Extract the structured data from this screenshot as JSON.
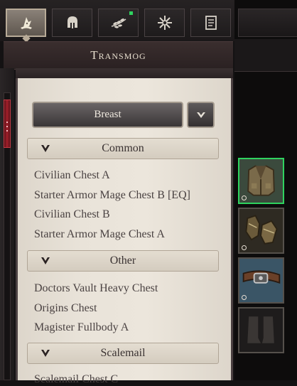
{
  "window": {
    "title": "Transmog"
  },
  "tabs": [
    {
      "name": "transmog",
      "icon": "wizard-hat-icon",
      "active": true
    },
    {
      "name": "helmet",
      "icon": "helmet-icon",
      "active": false
    },
    {
      "name": "laurel",
      "icon": "laurel-icon",
      "active": false,
      "has_notification": true
    },
    {
      "name": "snowflake",
      "icon": "snowflake-icon",
      "active": false
    },
    {
      "name": "journal",
      "icon": "book-icon",
      "active": false
    }
  ],
  "dropdown": {
    "selected": "Breast"
  },
  "categories": [
    {
      "label": "Common",
      "items": [
        "Civilian Chest A",
        "Starter Armor Mage Chest B [EQ]",
        "Civilian Chest B",
        "Starter Armor Mage Chest A"
      ]
    },
    {
      "label": "Other",
      "items": [
        "Doctors Vault Heavy Chest",
        "Origins Chest",
        "Magister Fullbody A"
      ]
    },
    {
      "label": "Scalemail",
      "items": [
        "Scalemail Chest C"
      ]
    }
  ],
  "slots": [
    {
      "icon": "chest-armor-icon",
      "selected": true
    },
    {
      "icon": "gloves-icon",
      "selected": false
    },
    {
      "icon": "belt-icon",
      "selected": false
    },
    {
      "icon": "boots-icon",
      "selected": false
    }
  ],
  "colors": {
    "accent_green": "#2fd35f",
    "scroll_red": "#a3202b",
    "parchment": "#ece6dc"
  }
}
